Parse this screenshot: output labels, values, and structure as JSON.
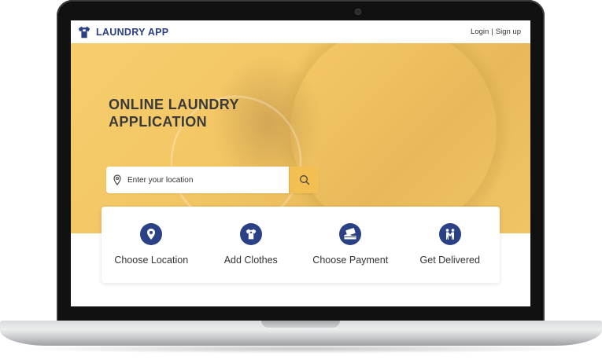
{
  "app": {
    "name": "LAUNDRY APP",
    "logo_icon": "shirt-logo-icon"
  },
  "nav": {
    "login": "Login",
    "separator": "|",
    "signup": "Sign up"
  },
  "hero": {
    "title_line1": "ONLINE LAUNDRY",
    "title_line2": "APPLICATION"
  },
  "search": {
    "placeholder": "Enter your location",
    "value": "",
    "location_icon": "location-pin-icon",
    "button_icon": "search-icon"
  },
  "steps": [
    {
      "label": "Choose Location",
      "icon": "location-pin-icon"
    },
    {
      "label": "Add Clothes",
      "icon": "shirt-icon"
    },
    {
      "label": "Choose Payment",
      "icon": "payment-card-icon"
    },
    {
      "label": "Get Delivered",
      "icon": "delivery-people-icon"
    }
  ],
  "colors": {
    "brand_blue": "#2b3f86",
    "accent_yellow": "#f3bf52",
    "hero_overlay": "#f4c865"
  }
}
